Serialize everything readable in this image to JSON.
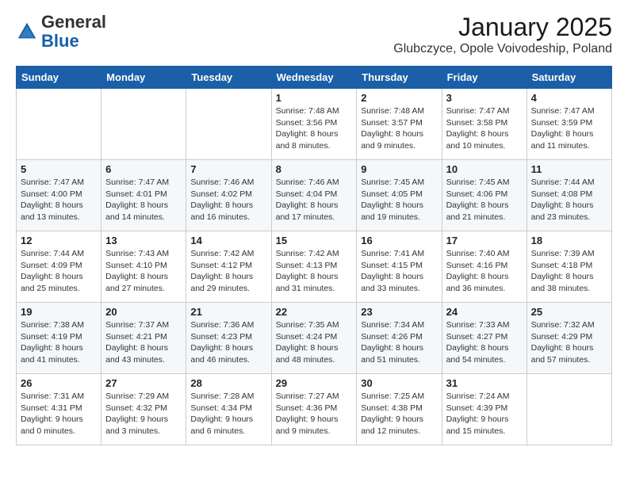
{
  "header": {
    "logo_general": "General",
    "logo_blue": "Blue",
    "month_title": "January 2025",
    "location": "Glubczyce, Opole Voivodeship, Poland"
  },
  "days_of_week": [
    "Sunday",
    "Monday",
    "Tuesday",
    "Wednesday",
    "Thursday",
    "Friday",
    "Saturday"
  ],
  "weeks": [
    [
      {
        "day": null
      },
      {
        "day": null
      },
      {
        "day": null
      },
      {
        "day": "1",
        "sunrise": "Sunrise: 7:48 AM",
        "sunset": "Sunset: 3:56 PM",
        "daylight": "Daylight: 8 hours and 8 minutes."
      },
      {
        "day": "2",
        "sunrise": "Sunrise: 7:48 AM",
        "sunset": "Sunset: 3:57 PM",
        "daylight": "Daylight: 8 hours and 9 minutes."
      },
      {
        "day": "3",
        "sunrise": "Sunrise: 7:47 AM",
        "sunset": "Sunset: 3:58 PM",
        "daylight": "Daylight: 8 hours and 10 minutes."
      },
      {
        "day": "4",
        "sunrise": "Sunrise: 7:47 AM",
        "sunset": "Sunset: 3:59 PM",
        "daylight": "Daylight: 8 hours and 11 minutes."
      }
    ],
    [
      {
        "day": "5",
        "sunrise": "Sunrise: 7:47 AM",
        "sunset": "Sunset: 4:00 PM",
        "daylight": "Daylight: 8 hours and 13 minutes."
      },
      {
        "day": "6",
        "sunrise": "Sunrise: 7:47 AM",
        "sunset": "Sunset: 4:01 PM",
        "daylight": "Daylight: 8 hours and 14 minutes."
      },
      {
        "day": "7",
        "sunrise": "Sunrise: 7:46 AM",
        "sunset": "Sunset: 4:02 PM",
        "daylight": "Daylight: 8 hours and 16 minutes."
      },
      {
        "day": "8",
        "sunrise": "Sunrise: 7:46 AM",
        "sunset": "Sunset: 4:04 PM",
        "daylight": "Daylight: 8 hours and 17 minutes."
      },
      {
        "day": "9",
        "sunrise": "Sunrise: 7:45 AM",
        "sunset": "Sunset: 4:05 PM",
        "daylight": "Daylight: 8 hours and 19 minutes."
      },
      {
        "day": "10",
        "sunrise": "Sunrise: 7:45 AM",
        "sunset": "Sunset: 4:06 PM",
        "daylight": "Daylight: 8 hours and 21 minutes."
      },
      {
        "day": "11",
        "sunrise": "Sunrise: 7:44 AM",
        "sunset": "Sunset: 4:08 PM",
        "daylight": "Daylight: 8 hours and 23 minutes."
      }
    ],
    [
      {
        "day": "12",
        "sunrise": "Sunrise: 7:44 AM",
        "sunset": "Sunset: 4:09 PM",
        "daylight": "Daylight: 8 hours and 25 minutes."
      },
      {
        "day": "13",
        "sunrise": "Sunrise: 7:43 AM",
        "sunset": "Sunset: 4:10 PM",
        "daylight": "Daylight: 8 hours and 27 minutes."
      },
      {
        "day": "14",
        "sunrise": "Sunrise: 7:42 AM",
        "sunset": "Sunset: 4:12 PM",
        "daylight": "Daylight: 8 hours and 29 minutes."
      },
      {
        "day": "15",
        "sunrise": "Sunrise: 7:42 AM",
        "sunset": "Sunset: 4:13 PM",
        "daylight": "Daylight: 8 hours and 31 minutes."
      },
      {
        "day": "16",
        "sunrise": "Sunrise: 7:41 AM",
        "sunset": "Sunset: 4:15 PM",
        "daylight": "Daylight: 8 hours and 33 minutes."
      },
      {
        "day": "17",
        "sunrise": "Sunrise: 7:40 AM",
        "sunset": "Sunset: 4:16 PM",
        "daylight": "Daylight: 8 hours and 36 minutes."
      },
      {
        "day": "18",
        "sunrise": "Sunrise: 7:39 AM",
        "sunset": "Sunset: 4:18 PM",
        "daylight": "Daylight: 8 hours and 38 minutes."
      }
    ],
    [
      {
        "day": "19",
        "sunrise": "Sunrise: 7:38 AM",
        "sunset": "Sunset: 4:19 PM",
        "daylight": "Daylight: 8 hours and 41 minutes."
      },
      {
        "day": "20",
        "sunrise": "Sunrise: 7:37 AM",
        "sunset": "Sunset: 4:21 PM",
        "daylight": "Daylight: 8 hours and 43 minutes."
      },
      {
        "day": "21",
        "sunrise": "Sunrise: 7:36 AM",
        "sunset": "Sunset: 4:23 PM",
        "daylight": "Daylight: 8 hours and 46 minutes."
      },
      {
        "day": "22",
        "sunrise": "Sunrise: 7:35 AM",
        "sunset": "Sunset: 4:24 PM",
        "daylight": "Daylight: 8 hours and 48 minutes."
      },
      {
        "day": "23",
        "sunrise": "Sunrise: 7:34 AM",
        "sunset": "Sunset: 4:26 PM",
        "daylight": "Daylight: 8 hours and 51 minutes."
      },
      {
        "day": "24",
        "sunrise": "Sunrise: 7:33 AM",
        "sunset": "Sunset: 4:27 PM",
        "daylight": "Daylight: 8 hours and 54 minutes."
      },
      {
        "day": "25",
        "sunrise": "Sunrise: 7:32 AM",
        "sunset": "Sunset: 4:29 PM",
        "daylight": "Daylight: 8 hours and 57 minutes."
      }
    ],
    [
      {
        "day": "26",
        "sunrise": "Sunrise: 7:31 AM",
        "sunset": "Sunset: 4:31 PM",
        "daylight": "Daylight: 9 hours and 0 minutes."
      },
      {
        "day": "27",
        "sunrise": "Sunrise: 7:29 AM",
        "sunset": "Sunset: 4:32 PM",
        "daylight": "Daylight: 9 hours and 3 minutes."
      },
      {
        "day": "28",
        "sunrise": "Sunrise: 7:28 AM",
        "sunset": "Sunset: 4:34 PM",
        "daylight": "Daylight: 9 hours and 6 minutes."
      },
      {
        "day": "29",
        "sunrise": "Sunrise: 7:27 AM",
        "sunset": "Sunset: 4:36 PM",
        "daylight": "Daylight: 9 hours and 9 minutes."
      },
      {
        "day": "30",
        "sunrise": "Sunrise: 7:25 AM",
        "sunset": "Sunset: 4:38 PM",
        "daylight": "Daylight: 9 hours and 12 minutes."
      },
      {
        "day": "31",
        "sunrise": "Sunrise: 7:24 AM",
        "sunset": "Sunset: 4:39 PM",
        "daylight": "Daylight: 9 hours and 15 minutes."
      },
      {
        "day": null
      }
    ]
  ]
}
